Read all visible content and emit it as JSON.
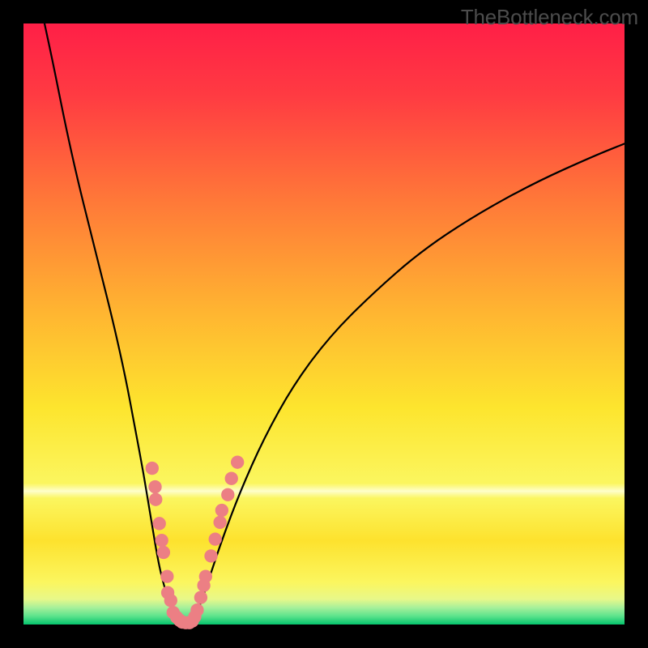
{
  "watermark": "TheBottleneck.com",
  "chart_data": {
    "type": "line",
    "title": "",
    "xlabel": "",
    "ylabel": "",
    "xlim": [
      0,
      100
    ],
    "ylim": [
      0,
      100
    ],
    "grid": false,
    "legend": false,
    "gradient_stops": [
      {
        "offset": 0.0,
        "color": "#ff1f47"
      },
      {
        "offset": 0.12,
        "color": "#ff3b42"
      },
      {
        "offset": 0.3,
        "color": "#ff7a38"
      },
      {
        "offset": 0.48,
        "color": "#ffb531"
      },
      {
        "offset": 0.64,
        "color": "#fde52e"
      },
      {
        "offset": 0.765,
        "color": "#fbf65f"
      },
      {
        "offset": 0.778,
        "color": "#fefecb"
      },
      {
        "offset": 0.79,
        "color": "#fbf65f"
      },
      {
        "offset": 0.86,
        "color": "#fde22e"
      },
      {
        "offset": 0.93,
        "color": "#fbf65f"
      },
      {
        "offset": 0.958,
        "color": "#e7f88a"
      },
      {
        "offset": 0.972,
        "color": "#a6f09a"
      },
      {
        "offset": 0.986,
        "color": "#5ce38c"
      },
      {
        "offset": 1.0,
        "color": "#05c36c"
      }
    ],
    "series": [
      {
        "name": "left-branch",
        "stroke": "#000000",
        "x": [
          3.5,
          5,
          7,
          9,
          11,
          13,
          15,
          17,
          18.5,
          20,
          21.3,
          22.5,
          23.5,
          24.5,
          25.2,
          25.9,
          26.5,
          27.0
        ],
        "y": [
          100,
          93,
          83,
          74,
          66,
          58,
          50,
          41,
          33,
          25,
          17,
          10,
          6,
          3,
          1.2,
          0.4,
          0.07,
          0.0
        ]
      },
      {
        "name": "right-branch",
        "stroke": "#000000",
        "x": [
          27.0,
          27.6,
          28.4,
          29.5,
          31,
          33,
          36,
          40,
          45,
          51,
          58,
          66,
          75,
          85,
          95,
          100
        ],
        "y": [
          0.0,
          0.2,
          1.0,
          3.5,
          8,
          14,
          22,
          31,
          40,
          48,
          55,
          62,
          68,
          73.5,
          78,
          80
        ]
      }
    ],
    "markers": {
      "name": "highlight-dots",
      "fill": "#ec7f84",
      "r": 1.1,
      "points": [
        [
          21.4,
          26.0
        ],
        [
          21.9,
          22.9
        ],
        [
          22.0,
          20.8
        ],
        [
          22.6,
          16.8
        ],
        [
          23.0,
          14.0
        ],
        [
          23.3,
          12.0
        ],
        [
          23.9,
          8.0
        ],
        [
          24.0,
          5.3
        ],
        [
          24.5,
          4.0
        ],
        [
          24.9,
          2.0
        ],
        [
          25.5,
          1.2
        ],
        [
          26.0,
          0.7
        ],
        [
          26.4,
          0.4
        ],
        [
          27.0,
          0.3
        ],
        [
          27.6,
          0.3
        ],
        [
          28.1,
          0.6
        ],
        [
          28.5,
          1.3
        ],
        [
          28.9,
          2.4
        ],
        [
          29.5,
          4.5
        ],
        [
          30.0,
          6.5
        ],
        [
          30.3,
          8.0
        ],
        [
          31.2,
          11.4
        ],
        [
          31.9,
          14.2
        ],
        [
          32.7,
          17.0
        ],
        [
          33.0,
          19.0
        ],
        [
          34.0,
          21.6
        ],
        [
          34.6,
          24.3
        ],
        [
          35.6,
          27.0
        ]
      ]
    },
    "optimum_x_fraction": 0.27
  }
}
